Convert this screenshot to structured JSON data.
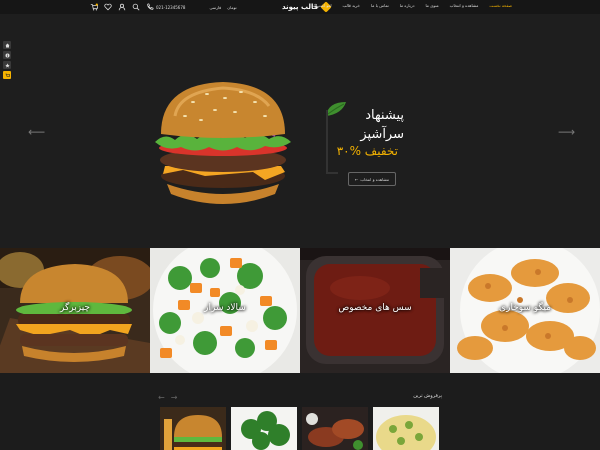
{
  "colors": {
    "accent": "#f5b301",
    "background": "#1c1c1c",
    "header": "#161616"
  },
  "header": {
    "logo_text": "قالب پیوند",
    "nav": [
      {
        "label": "صفحه نخست",
        "active": true
      },
      {
        "label": "مشاهده و انتخاب",
        "active": false
      },
      {
        "label": "منوی ما",
        "active": false
      },
      {
        "label": "درباره ما",
        "active": false
      },
      {
        "label": "تماس با ما",
        "active": false
      },
      {
        "label": "خرید قالب",
        "active": false
      },
      {
        "label": "لغو اشتراک",
        "active": false
      }
    ],
    "phone": "021-12345678",
    "language": "فارسی",
    "currency": "تومان",
    "icons": [
      "cart-icon",
      "heart-icon",
      "user-icon",
      "search-icon",
      "phone-icon"
    ]
  },
  "side_bar": {
    "icons": [
      "home-icon",
      "info-icon",
      "star-icon",
      "cart-icon"
    ]
  },
  "hero": {
    "title_line1": "پیشنهاد",
    "title_line2": "سرآشپز",
    "discount": "۳۰% تخفیف",
    "button_label": "مشاهده و انتخاب",
    "prev_icon": "arrow-left-icon",
    "next_icon": "arrow-right-icon"
  },
  "categories": [
    {
      "label": "چیزبرگر"
    },
    {
      "label": "سالاد سزار"
    },
    {
      "label": "سس های مخصوص"
    },
    {
      "label": "میگو سوخاری"
    }
  ],
  "bestsellers": {
    "title": "پرفروش ترین"
  }
}
